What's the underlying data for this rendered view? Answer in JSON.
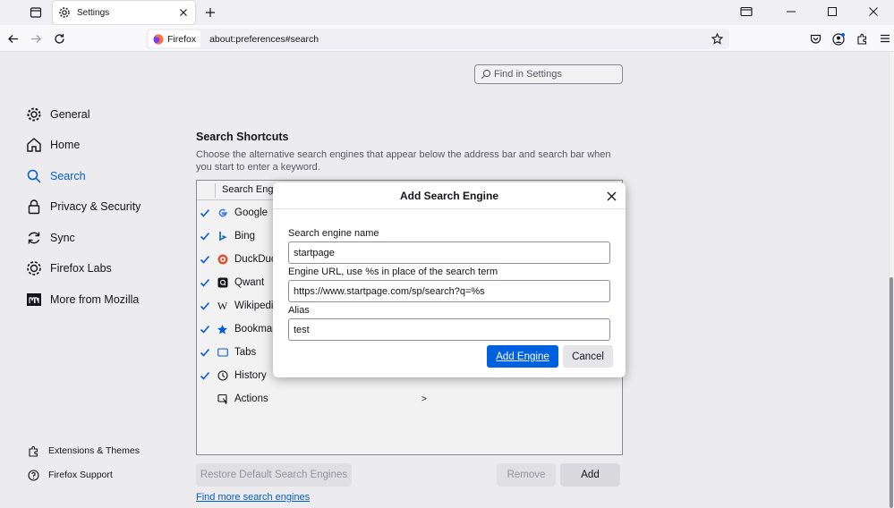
{
  "tab": {
    "title": "Settings"
  },
  "urlbar": {
    "identity_label": "Firefox",
    "url": "about:preferences#search"
  },
  "find": {
    "placeholder": "Find in Settings"
  },
  "sidebar": {
    "items": [
      {
        "label": "General",
        "icon": "gear-icon"
      },
      {
        "label": "Home",
        "icon": "home-icon"
      },
      {
        "label": "Search",
        "icon": "search-icon",
        "selected": true
      },
      {
        "label": "Privacy & Security",
        "icon": "lock-icon"
      },
      {
        "label": "Sync",
        "icon": "sync-icon"
      },
      {
        "label": "Firefox Labs",
        "icon": "labs-icon"
      },
      {
        "label": "More from Mozilla",
        "icon": "mozilla-icon"
      }
    ],
    "footer": [
      {
        "label": "Extensions & Themes",
        "icon": "puzzle-icon"
      },
      {
        "label": "Firefox Support",
        "icon": "help-icon"
      }
    ]
  },
  "shortcuts": {
    "title": "Search Shortcuts",
    "description": "Choose the alternative search engines that appear below the address bar and search bar when you start to enter a keyword.",
    "column_header": "Search Engine",
    "engines": [
      {
        "name": "Google",
        "checked": true,
        "icon": "G"
      },
      {
        "name": "Bing",
        "checked": true,
        "icon": "b"
      },
      {
        "name": "DuckDuckGo",
        "checked": true,
        "icon": "D"
      },
      {
        "name": "Qwant",
        "checked": true,
        "icon": "Q"
      },
      {
        "name": "Wikipedia (en)",
        "checked": true,
        "icon": "W"
      },
      {
        "name": "Bookmarks",
        "checked": true,
        "icon": "★"
      },
      {
        "name": "Tabs",
        "checked": true,
        "icon": "tab"
      },
      {
        "name": "History",
        "checked": true,
        "icon": "clock"
      },
      {
        "name": "Actions",
        "checked": false,
        "icon": "actions",
        "arrow": ">"
      }
    ],
    "restore_label": "Restore Default Search Engines",
    "remove_label": "Remove",
    "add_label": "Add",
    "find_more_label": "Find more search engines"
  },
  "dialog": {
    "title": "Add Search Engine",
    "name_label": "Search engine name",
    "name_value": "startpage",
    "url_label": "Engine URL, use %s in place of the search term",
    "url_value": "https://www.startpage.com/sp/search?q=%s",
    "alias_label": "Alias",
    "alias_value": "test",
    "add_button": "Add Engine",
    "cancel_button": "Cancel"
  },
  "colors": {
    "accent": "#0061e0",
    "text": "#15141a",
    "muted": "#5b5b66"
  }
}
